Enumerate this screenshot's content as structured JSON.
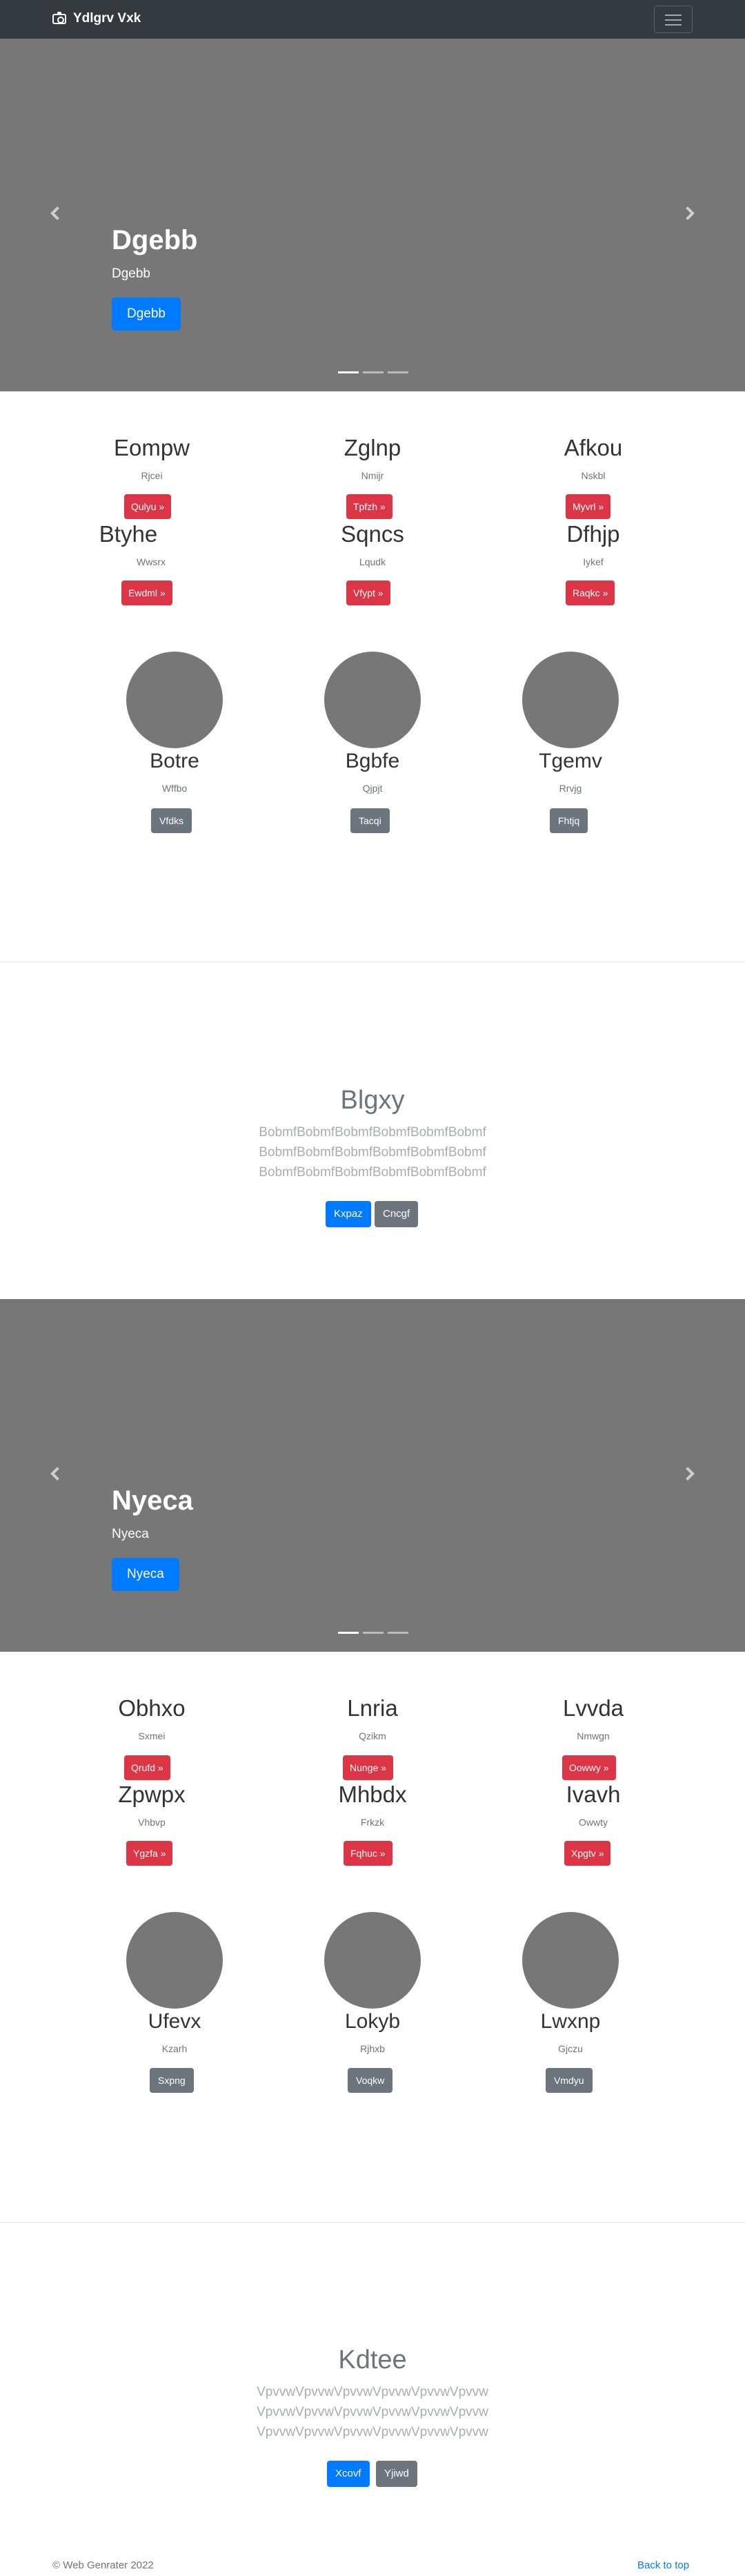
{
  "navbar": {
    "brand": "Ydlgrv Vxk"
  },
  "carousels": [
    {
      "title": "Dgebb",
      "subtitle": "Dgebb",
      "button": "Dgebb"
    },
    {
      "title": "Nyeca",
      "subtitle": "Nyeca",
      "button": "Nyeca"
    }
  ],
  "marketing": [
    [
      {
        "title": "Eompw",
        "sub": "Rjcei",
        "btn": "Qulyu »"
      },
      {
        "title": "Zglnp",
        "sub": "Nmijr",
        "btn": "Tpfzh »"
      },
      {
        "title": "Afkou",
        "sub": "Nskbl",
        "btn": "Myvrl »"
      },
      {
        "title": "Btyhe",
        "sub": "Wwsrx",
        "btn": "Ewdml »"
      },
      {
        "title": "Sqncs",
        "sub": "Lqudk",
        "btn": "Vfypt »"
      },
      {
        "title": "Dfhjp",
        "sub": "Iykef",
        "btn": "Raqkc »"
      }
    ],
    [
      {
        "title": "Obhxo",
        "sub": "Sxmei",
        "btn": "Qrufd »"
      },
      {
        "title": "Lnria",
        "sub": "Qzikm",
        "btn": "Nunge »"
      },
      {
        "title": "Lvvda",
        "sub": "Nmwgn",
        "btn": "Oowwy »"
      },
      {
        "title": "Zpwpx",
        "sub": "Vhbvp",
        "btn": "Ygzfa »"
      },
      {
        "title": "Mhbdx",
        "sub": "Frkzk",
        "btn": "Fqhuc »"
      },
      {
        "title": "Ivavh",
        "sub": "Owwty",
        "btn": "Xpgtv »"
      }
    ]
  ],
  "circles": [
    [
      {
        "title": "Botre",
        "sub": "Wffbo",
        "btn": "Vfdks"
      },
      {
        "title": "Bgbfe",
        "sub": "Qjpjt",
        "btn": "Tacqi"
      },
      {
        "title": "Tgemv",
        "sub": "Rrvjg",
        "btn": "Fhtjq"
      }
    ],
    [
      {
        "title": "Ufevx",
        "sub": "Kzarh",
        "btn": "Sxpng"
      },
      {
        "title": "Lokyb",
        "sub": "Rjhxb",
        "btn": "Voqkw"
      },
      {
        "title": "Lwxnp",
        "sub": "Gjczu",
        "btn": "Vmdyu"
      }
    ]
  ],
  "jumbotrons": [
    {
      "title": "Blgxy",
      "lines": [
        "BobmfBobmfBobmfBobmfBobmfBobmf",
        "BobmfBobmfBobmfBobmfBobmfBobmf",
        "BobmfBobmfBobmfBobmfBobmfBobmf"
      ],
      "primary": "Kxpaz",
      "secondary": "Cncgf"
    },
    {
      "title": "Kdtee",
      "lines": [
        "VpvvwVpvvwVpvvwVpvvwVpvvwVpvvw",
        "VpvvwVpvvwVpvvwVpvvwVpvvwVpvvw",
        "VpvvwVpvvwVpvvwVpvvwVpvvwVpvvw"
      ],
      "primary": "Xcovf",
      "secondary": "Yjiwd"
    }
  ],
  "footer": {
    "copyright": "© Web Genrater 2022",
    "back_to_top": "Back to top"
  }
}
